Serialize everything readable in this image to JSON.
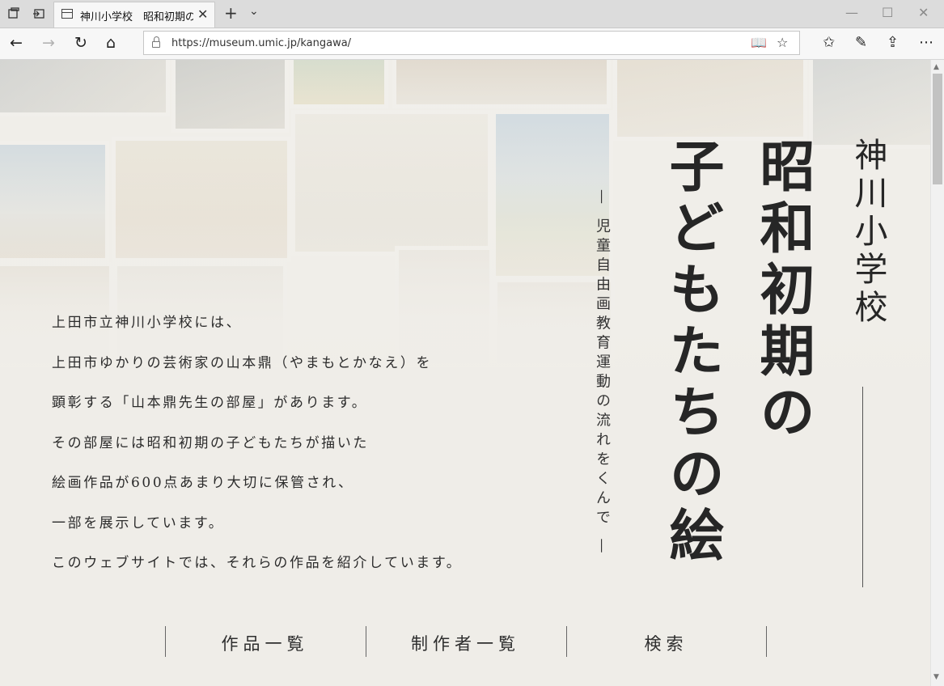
{
  "browser": {
    "tab": {
      "title": "神川小学校　昭和初期の子どもたちの絵",
      "close_glyph": "✕"
    },
    "new_tab_glyph": "+",
    "tab_list_glyph": "⌄",
    "window": {
      "minimize": "—",
      "maximize": "☐",
      "close": "✕"
    },
    "nav": {
      "back": "←",
      "forward": "→",
      "refresh": "↻",
      "home": "⌂"
    },
    "address": {
      "url": "https://museum.umic.jp/kangawa/"
    },
    "icons": {
      "tab_actions": "tabs-aside-icon",
      "set_aside": "set-aside-icon",
      "reading_view": "reading-view-icon",
      "favorite": "star-icon",
      "favorites_hub": "favorites-hub-icon",
      "notes": "pen-icon",
      "share": "share-icon",
      "more": "ellipsis-icon"
    },
    "glyphs": {
      "reading": "📖",
      "star": "☆",
      "hub": "✩",
      "pen": "✎",
      "share": "⇪",
      "more": "⋯"
    }
  },
  "page": {
    "intro_lines": [
      "上田市立神川小学校には、",
      "上田市ゆかりの芸術家の山本鼎（やまもとかなえ）を",
      "顕彰する「山本鼎先生の部屋」があります。",
      "その部屋には昭和初期の子どもたちが描いた",
      "絵画作品が600点あまり大切に保管され、",
      "一部を展示しています。",
      "このウェブサイトでは、それらの作品を紹介しています。"
    ],
    "school_name": "神川小学校",
    "title_col1": "昭和初期の",
    "title_col2": "子どもたちの絵",
    "subtitle": "— 児童自由画教育運動の流れをくんで —",
    "menu": [
      "作品一覧",
      "制作者一覧",
      "検索"
    ]
  }
}
